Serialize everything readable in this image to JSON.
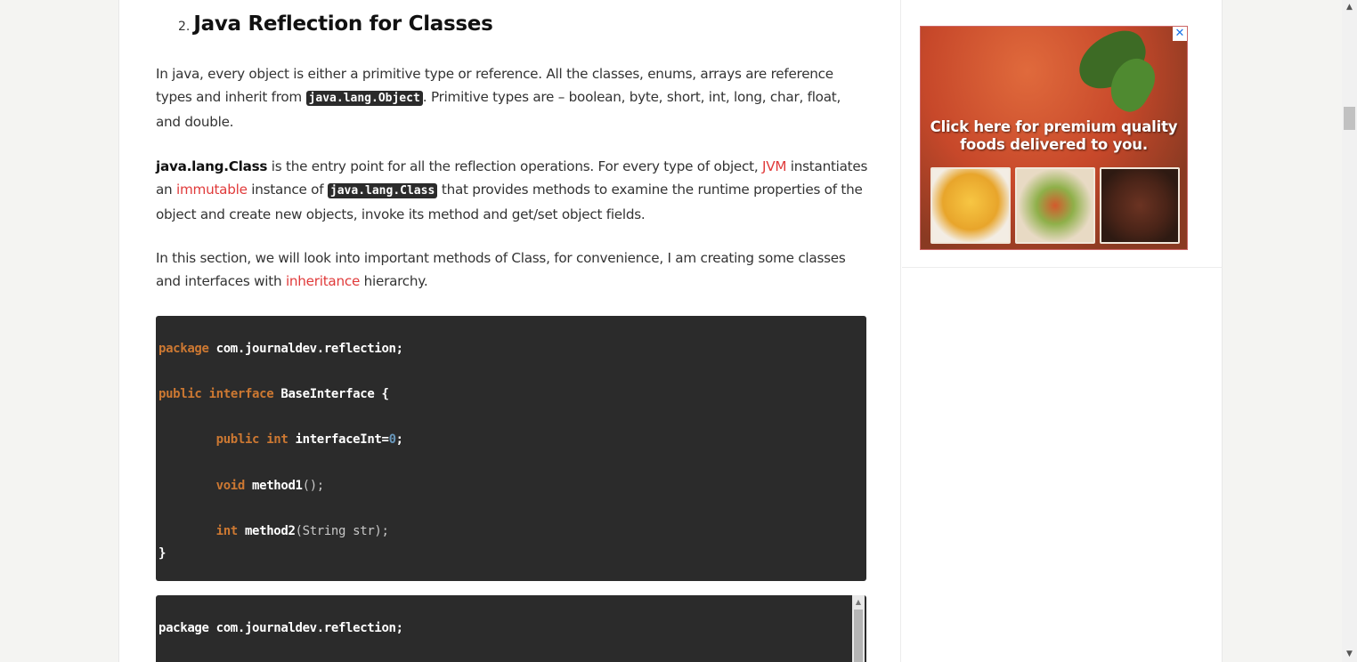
{
  "section": {
    "number": "2.",
    "title": "Java Reflection for Classes"
  },
  "para1": {
    "t1": "In java, every object is either a primitive type or reference. All the classes, enums, arrays are reference types and inherit from ",
    "code": "java.lang.Object",
    "t2": ". Primitive types are – boolean, byte, short, int, long, char, float, and double."
  },
  "para2": {
    "bold": "java.lang.Class",
    "t1": " is the entry point for all the reflection operations. For every type of object, ",
    "link_jvm": "JVM",
    "t2": " instantiates an ",
    "link_immutable": "immutable",
    "t3": " instance of ",
    "code": "java.lang.Class",
    "t4": " that provides methods to examine the runtime properties of the object and create new objects, invoke its method and get/set object fields."
  },
  "para3": {
    "t1": "In this section, we will look into important methods of Class, for convenience, I am creating some classes and interfaces with ",
    "link_inheritance": "inheritance",
    "t2": " hierarchy."
  },
  "code1": {
    "kw_package": "package",
    "package_name": " com.journaldev.reflection;",
    "kw_public": "public",
    "kw_interface": "interface",
    "iface_name": " BaseInterface {",
    "kw_public2": "public",
    "kw_int": "int",
    "field": " interfaceInt=",
    "zero": "0",
    "semi": ";",
    "kw_void": "void",
    "m1": " method1",
    "m1_args": "();",
    "kw_int2": "int",
    "m2": " method2",
    "m2_args": "(String str);",
    "close": "}"
  },
  "code2": {
    "line1": "package com.journaldev.reflection;"
  },
  "ad": {
    "close_label": "✕",
    "text": "Click here for premium quality foods delivered to you."
  },
  "scrollbar": {
    "up": "▲",
    "down": "▼"
  },
  "colors": {
    "link": "#e03a3a",
    "code_bg": "#2b2b2b",
    "keyword": "#cc7832",
    "number": "#6897bb"
  }
}
